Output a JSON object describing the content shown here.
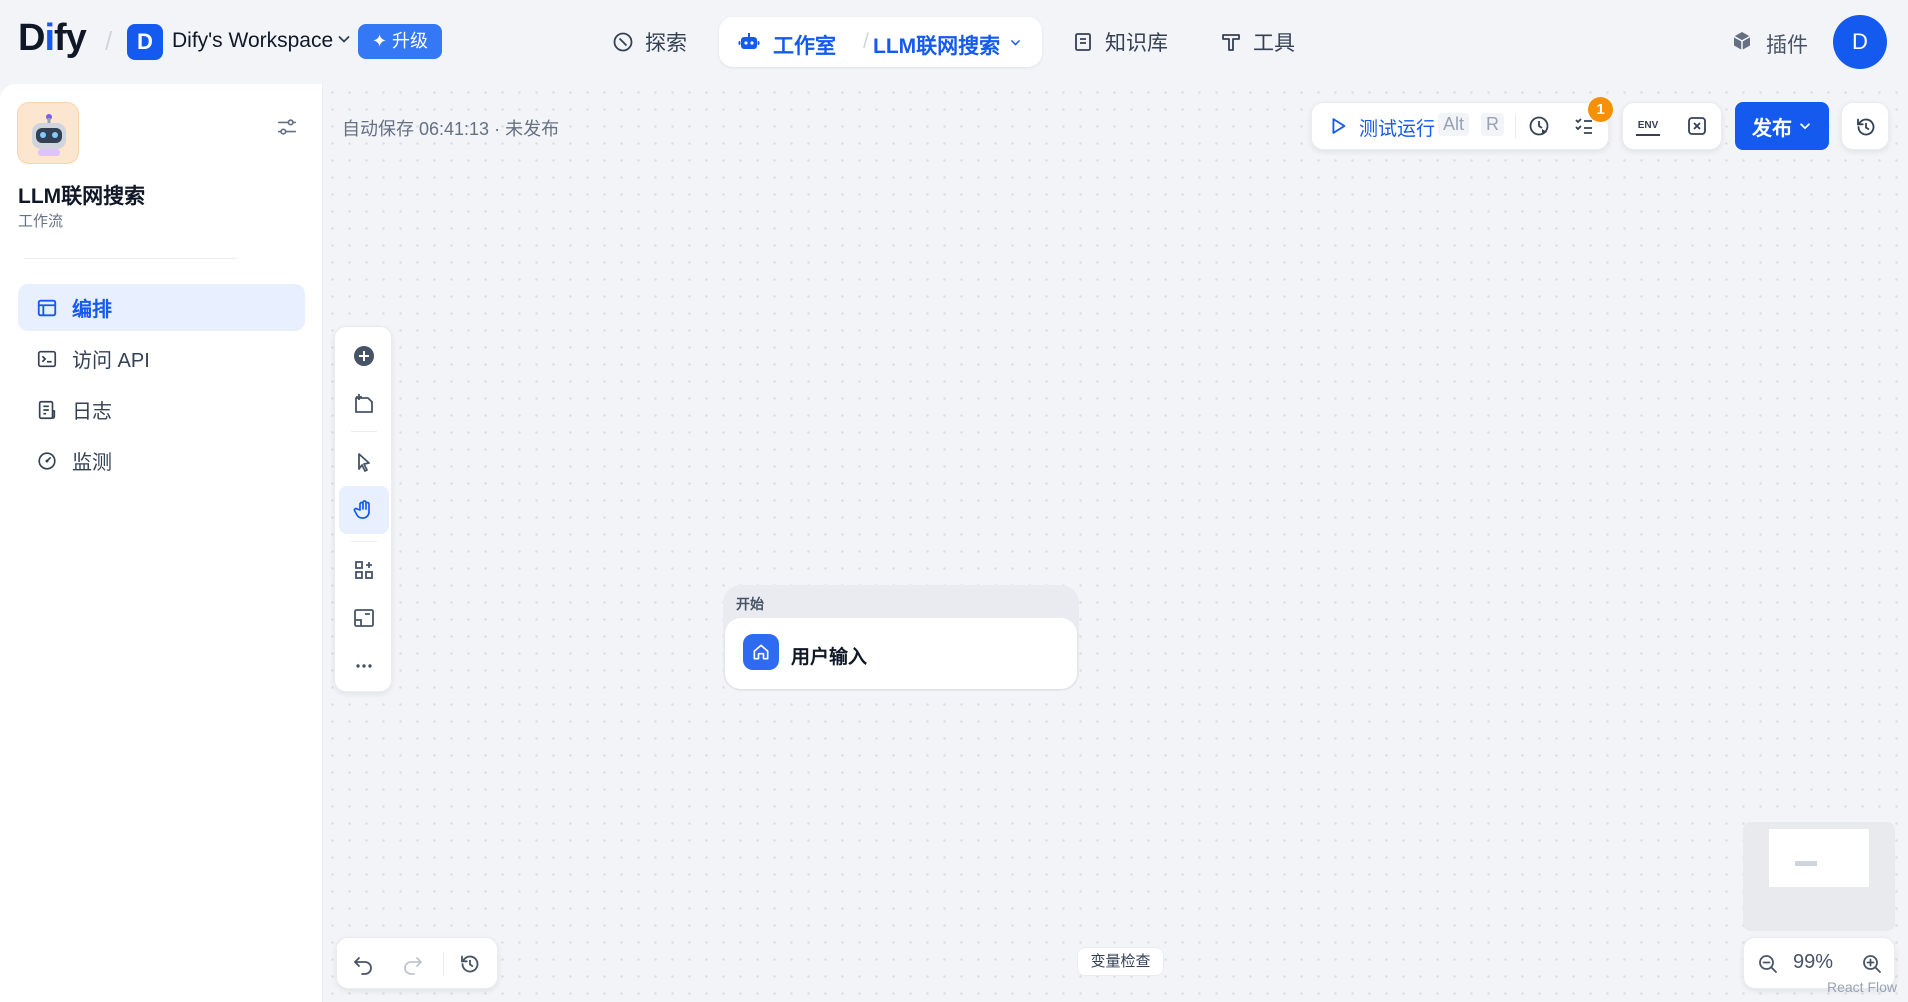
{
  "header": {
    "logo": {
      "main": "D",
      "accent": "i",
      "rest": "fy"
    },
    "workspace": {
      "initial": "D",
      "name": "Dify's Workspace"
    },
    "upgrade_label": "升级",
    "nav": {
      "explore": "探索",
      "studio": "工作室",
      "current_app": "LLM联网搜索",
      "knowledge": "知识库",
      "tools": "工具",
      "plugins": "插件"
    },
    "user_initial": "D"
  },
  "sidebar": {
    "app_name": "LLM联网搜索",
    "app_type": "工作流",
    "items": [
      {
        "label": "编排",
        "active": true,
        "icon": "layout-icon"
      },
      {
        "label": "访问 API",
        "active": false,
        "icon": "terminal-icon"
      },
      {
        "label": "日志",
        "active": false,
        "icon": "file-list-icon"
      },
      {
        "label": "监测",
        "active": false,
        "icon": "dashboard-icon"
      }
    ]
  },
  "canvas": {
    "autosave": "自动保存 06:41:13 · 未发布",
    "toolbar": {
      "run_label": "测试运行",
      "shortcut_alt": "Alt",
      "shortcut_key": "R",
      "checklist_badge": "1",
      "env_label": "ENV",
      "publish_label": "发布"
    },
    "start_node": {
      "header": "开始",
      "title": "用户输入"
    },
    "variable_inspect": "变量检查",
    "zoom": "99%",
    "attribution": "React Flow"
  },
  "colors": {
    "accent": "#155aef",
    "badge": "#f79009",
    "canvas_bg": "#f2f4f7"
  }
}
